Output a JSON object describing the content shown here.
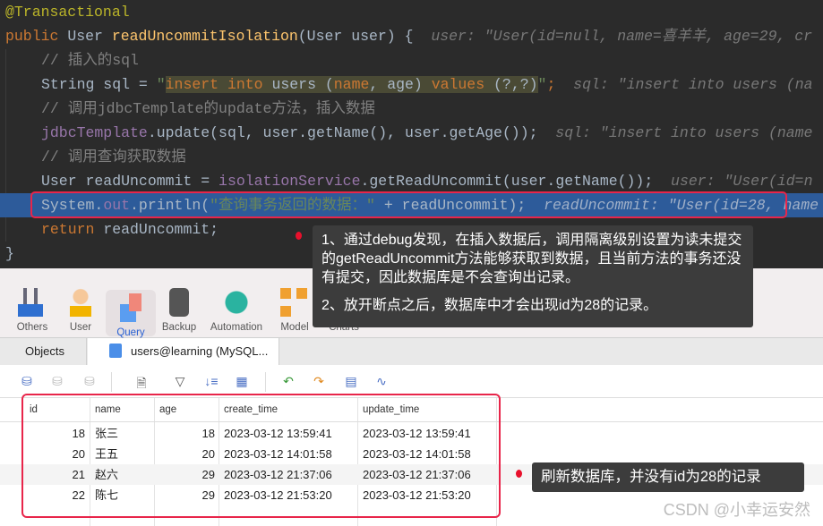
{
  "code": {
    "l1": "@Transactional",
    "l2": {
      "kw": "public",
      "type": " User ",
      "fn": "readUncommitIsolation",
      "rest": "(User user) {",
      "hint": "  user: \"User(id=null, name=喜羊羊, age=29, cr"
    },
    "l3": "// 插入的sql",
    "l4": {
      "a": "String sql = ",
      "q1": "\"",
      "s1": "insert into",
      "s2": " users ",
      "s3": "(",
      "s4": "name",
      "s5": ", age) ",
      "s6": "values",
      "s7": " (?,?)",
      "q2": "\"",
      ";": ";",
      "hint": "  sql: \"insert into users (na"
    },
    "l5": "// 调用jdbcTemplate的update方法，插入数据",
    "l6": {
      "f": "jdbcTemplate",
      "r": ".update(sql, user.getName(), user.getAge());",
      "hint": "  sql: \"insert into users (name"
    },
    "l7": "// 调用查询获取数据",
    "l8": {
      "a": "User readUncommit = ",
      "f": "isolationService",
      "r": ".getReadUncommit(user.getName());",
      "hint": "  user: \"User(id=n"
    },
    "l9": {
      "a": "System.",
      "f": "out",
      "b": ".println(",
      "s": "\"查询事务返回的数据：\"",
      "r": " + readUncommit);",
      "hint": "  readUncommit: \"User(id=28, name"
    },
    "l10": {
      "kw": "return",
      "r": " readUncommit;"
    },
    "l11": "}"
  },
  "toolbar": [
    {
      "label": "Others"
    },
    {
      "label": "User"
    },
    {
      "label": "Query",
      "selected": true
    },
    {
      "label": "Backup"
    },
    {
      "label": "Automation"
    },
    {
      "label": "Model"
    },
    {
      "label": "Charts"
    }
  ],
  "tabs": [
    {
      "label": "Objects"
    },
    {
      "label": "users@learning (MySQL..."
    }
  ],
  "table": {
    "columns": [
      "id",
      "name",
      "age",
      "create_time",
      "update_time"
    ],
    "rows": [
      [
        "18",
        "张三",
        "18",
        "2023-03-12 13:59:41",
        "2023-03-12 13:59:41"
      ],
      [
        "20",
        "王五",
        "20",
        "2023-03-12 14:01:58",
        "2023-03-12 14:01:58"
      ],
      [
        "21",
        "赵六",
        "29",
        "2023-03-12 21:37:06",
        "2023-03-12 21:37:06"
      ],
      [
        "22",
        "陈七",
        "29",
        "2023-03-12 21:53:20",
        "2023-03-12 21:53:20"
      ]
    ]
  },
  "annotations": {
    "tip1_p1": "1、通过debug发现，在插入数据后，调用隔离级别设置为读未提交的getReadUncommit方法能够获取到数据，且当前方法的事务还没有提交，因此数据库是不会查询出记录。",
    "tip1_p2": "2、放开断点之后，数据库中才会出现id为28的记录。",
    "tip2": "刷新数据库，并没有id为28的记录"
  },
  "watermark": "CSDN @小幸运安然",
  "colors": {
    "highlight": "#2d5b9a",
    "annotation_border": "#e8254a",
    "accent": "#2a62d4"
  }
}
